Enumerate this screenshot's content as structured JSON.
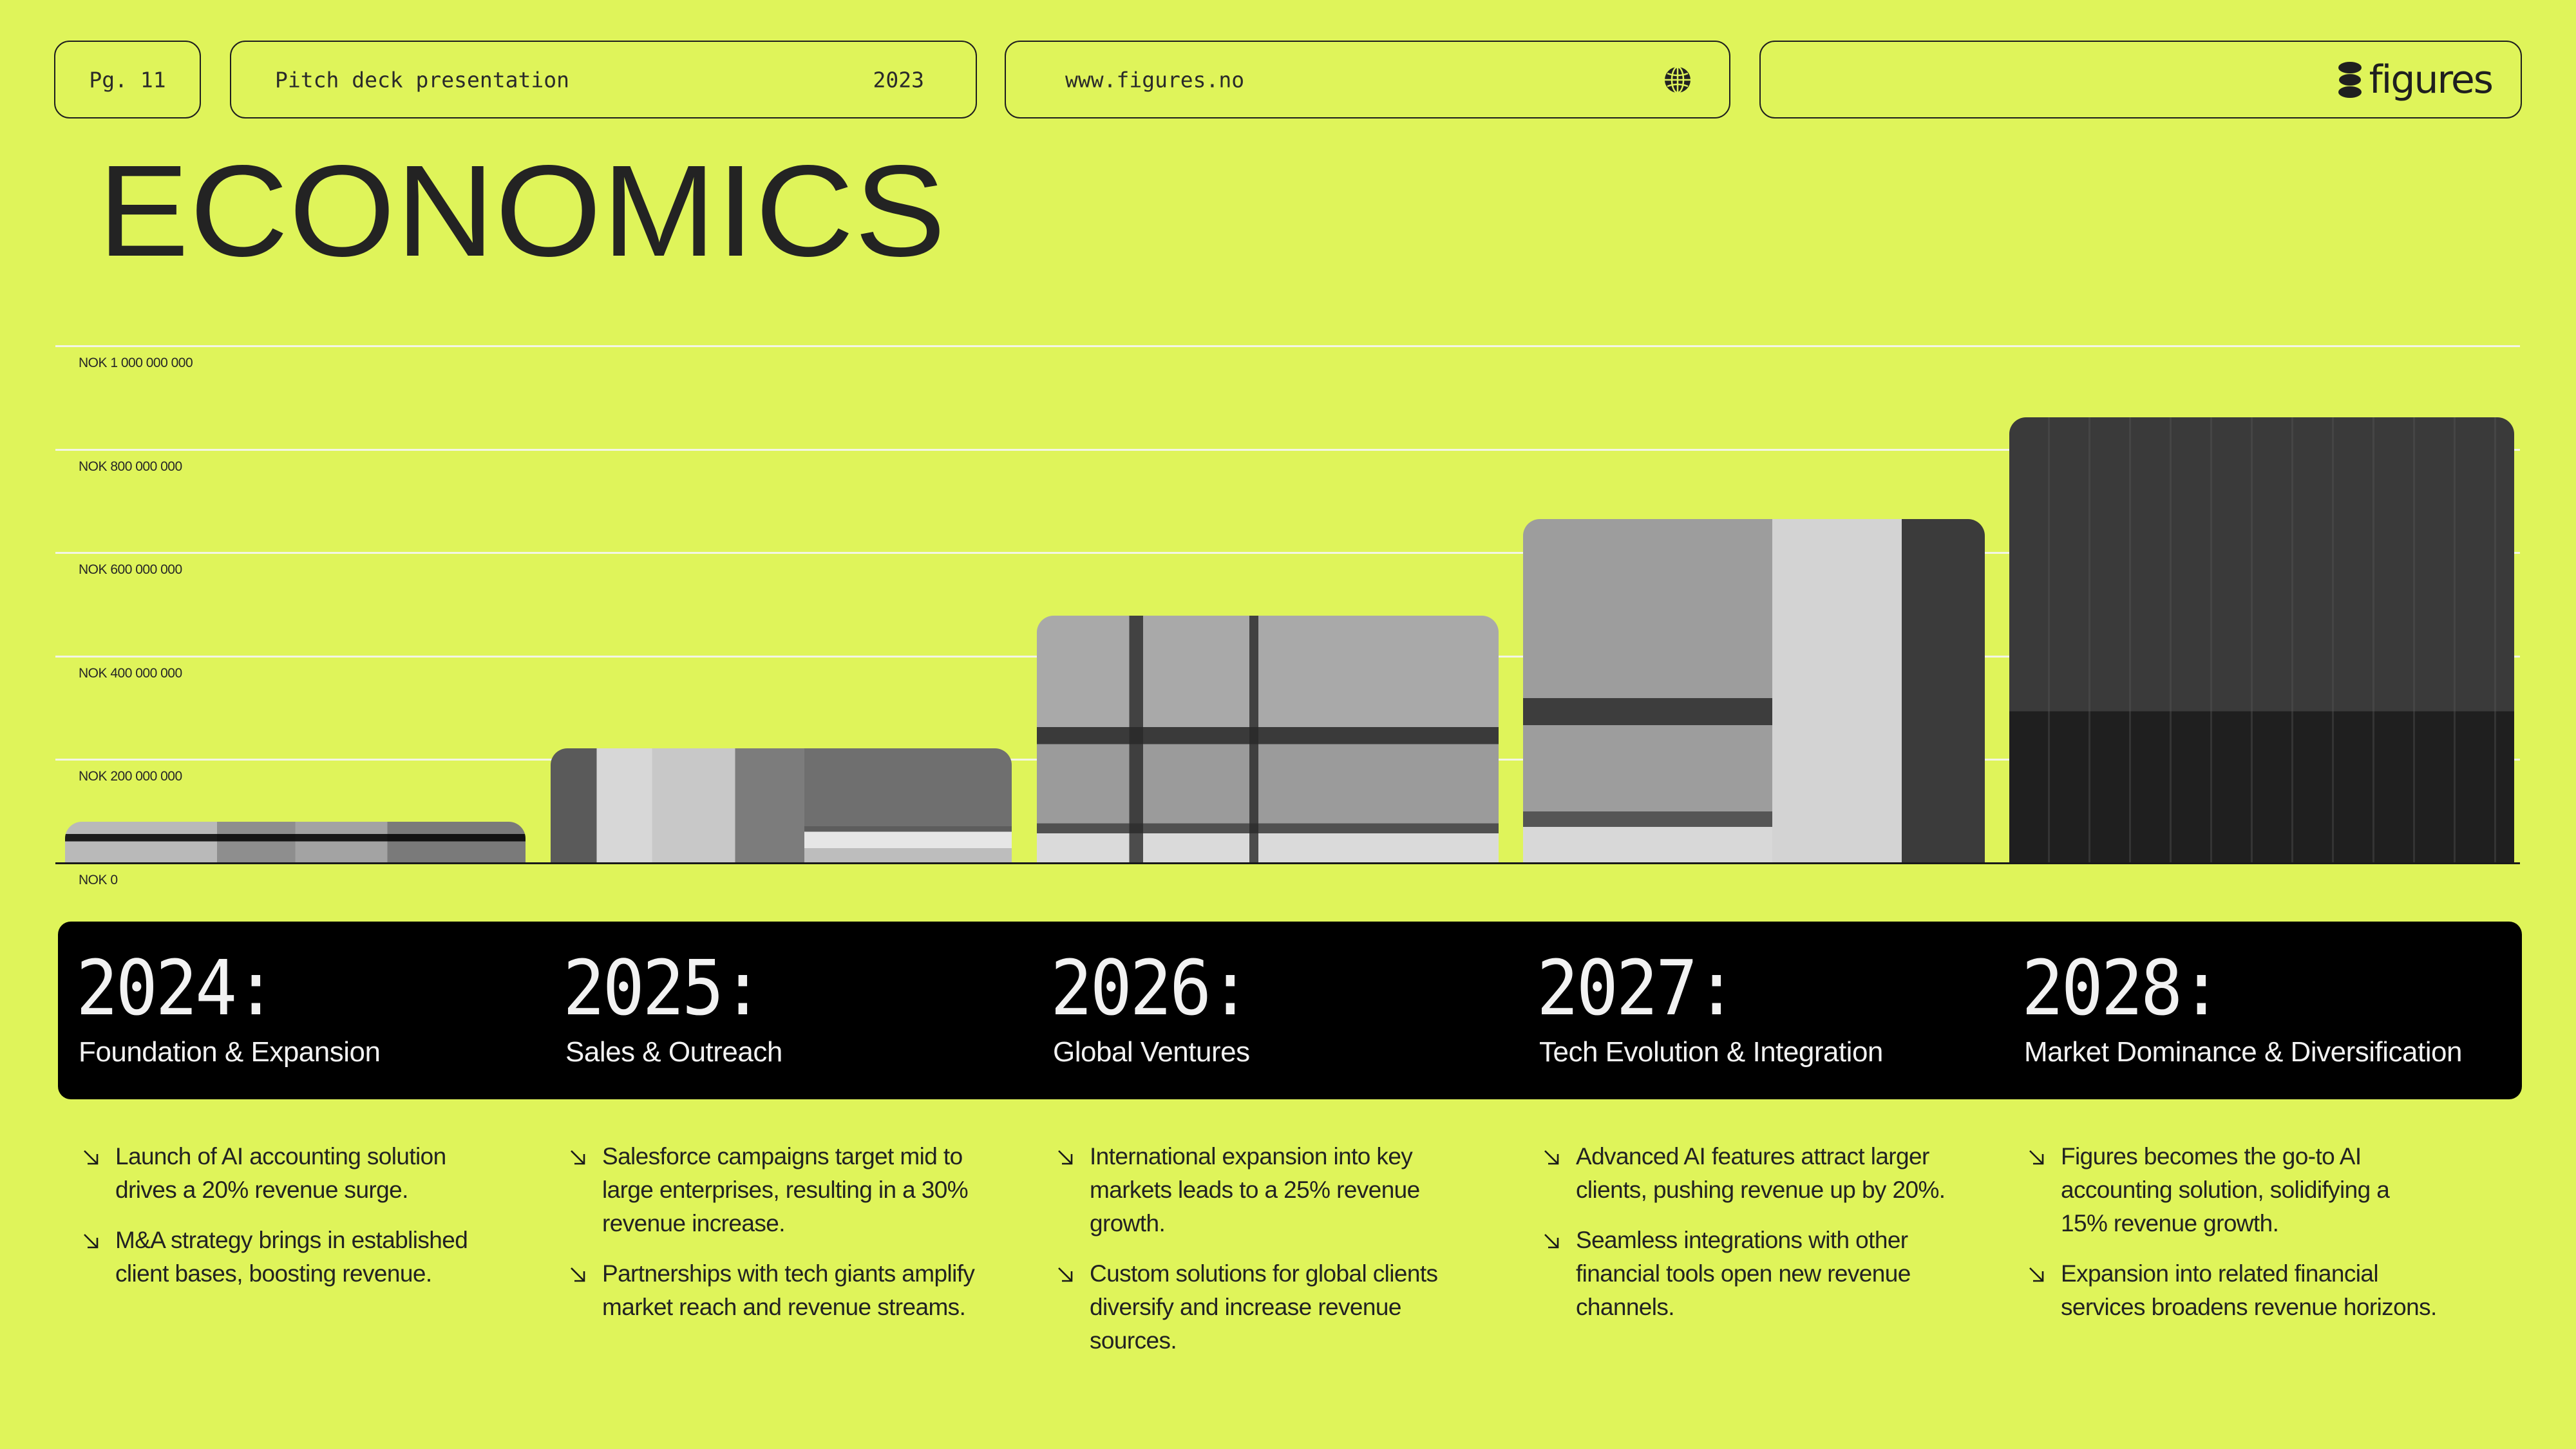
{
  "header": {
    "page_label": "Pg. 11",
    "deck_title": "Pitch deck presentation",
    "deck_year": "2023",
    "website": "www.figures.no",
    "website_icon": "globe-icon",
    "brand_name": "figures",
    "brand_icon": "figures-logo-mark"
  },
  "page_title": "ECONOMICS",
  "colors": {
    "background": "#dff45a",
    "text": "#222222",
    "band": "#000000",
    "band_text": "#f2f2f2",
    "gridline": "#f3f5e6"
  },
  "chart_data": {
    "type": "bar",
    "title": "ECONOMICS",
    "xlabel": "",
    "ylabel": "",
    "currency": "NOK",
    "categories": [
      "2024",
      "2025",
      "2026",
      "2027",
      "2028"
    ],
    "values": [
      80000000,
      222000000,
      478000000,
      665000000,
      862000000
    ],
    "ylim": [
      0,
      1000000000
    ],
    "yticks": [
      0,
      200000000,
      400000000,
      600000000,
      800000000,
      1000000000
    ],
    "ytick_labels": [
      "NOK 0",
      "NOK 200 000 000",
      "NOK 400 000 000",
      "NOK 600 000 000",
      "NOK 800 000 000",
      "NOK 1 000 000 000"
    ],
    "grid": true,
    "legend": "none",
    "bar_fill": "grayscale photo"
  },
  "timeline": [
    {
      "year": "2024:",
      "phase": "Foundation & Expansion",
      "bullets": [
        "Launch of AI accounting solution drives a 20% revenue surge.",
        "M&A strategy brings in established client bases, boosting revenue."
      ]
    },
    {
      "year": "2025:",
      "phase": "Sales & Outreach",
      "bullets": [
        "Salesforce campaigns target mid to large enterprises, resulting in a 30% revenue increase.",
        "Partnerships with tech giants amplify market reach and revenue streams."
      ]
    },
    {
      "year": "2026:",
      "phase": "Global Ventures",
      "bullets": [
        "International expansion into key markets leads to a 25% revenue growth.",
        "Custom solutions for global clients diversify and increase revenue sources."
      ]
    },
    {
      "year": "2027:",
      "phase": "Tech Evolution & Integration",
      "bullets": [
        "Advanced AI features attract larger clients, pushing revenue up by 20%.",
        "Seamless integrations with other financial tools open new revenue channels."
      ]
    },
    {
      "year": "2028:",
      "phase": "Market Dominance & Diversification",
      "bullets": [
        "Figures becomes the go-to AI accounting solution, solidifying a 15% revenue growth.",
        "Expansion into related financial services broadens revenue horizons."
      ]
    }
  ],
  "bullet_icon": "arrow-down-right-icon"
}
